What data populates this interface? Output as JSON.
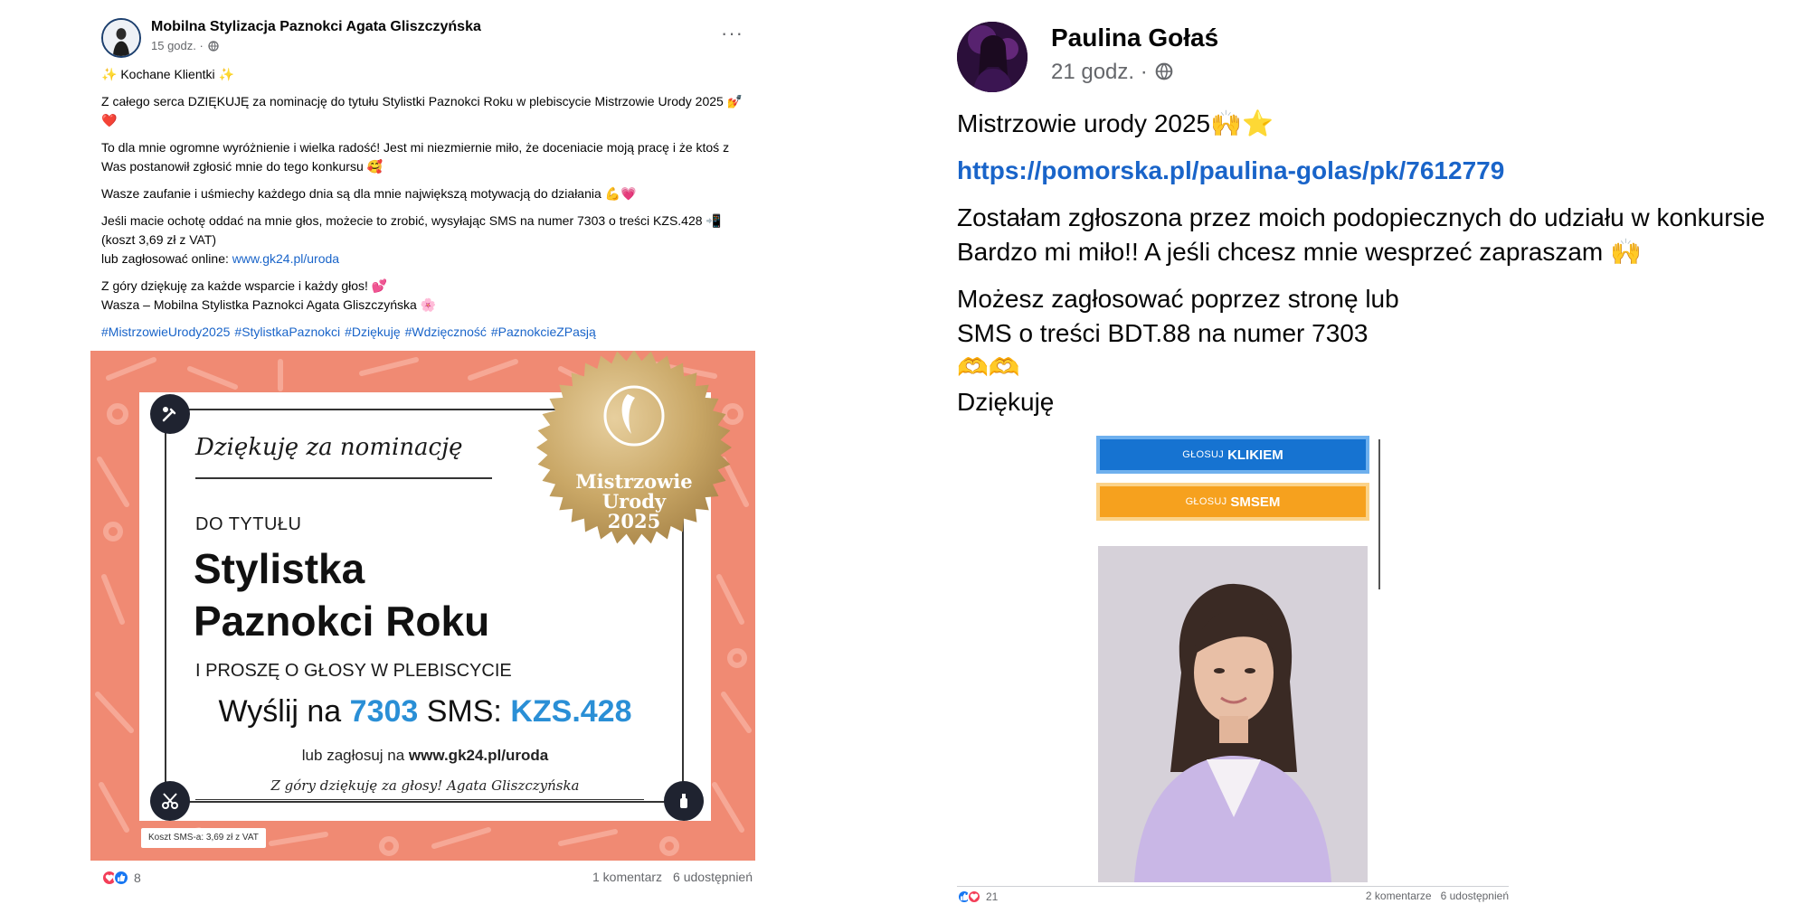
{
  "left_post": {
    "author": "Mobilna Stylizacja Paznokci Agata Gliszczyńska",
    "time": "15 godz. ·",
    "more": "···",
    "greeting": "✨ Kochane Klientki ✨",
    "para1": "Z całego serca DZIĘKUJĘ za nominację do tytułu Stylistki Paznokci Roku w plebiscycie Mistrzowie Urody 2025 💅❤️",
    "para2": "To dla mnie ogromne wyróżnienie i wielka radość! Jest mi niezmiernie miło, że doceniacie moją pracę i że ktoś z Was postanowił zgłosić mnie do tego konkursu 🥰",
    "para3": "Wasze zaufanie i uśmiechy każdego dnia są dla mnie największą motywacją do działania 💪💗",
    "para4_line1": "Jeśli macie ochotę oddać na mnie głos, możecie to zrobić, wysyłając SMS na numer 7303 o treści KZS.428 📲 (koszt 3,69 zł z VAT)",
    "para4_line2_prefix": "lub zagłosować online: ",
    "para4_link": "www.gk24.pl/uroda",
    "para5_line1": "Z góry dziękuję za każde wsparcie i każdy głos! 💕",
    "para5_line2": "Wasza – Mobilna Stylistka Paznokci Agata Gliszczyńska 🌸",
    "hashtags": [
      "#MistrzowieUrody2025",
      "#StylistkaPaznokci",
      "#Dziękuję",
      "#Wdzięczność",
      "#PaznokcieZPasją"
    ],
    "promo": {
      "title": "Dziękuję za nominację",
      "do_tytulu": "DO TYTUŁU",
      "big1": "Stylistka",
      "big2": "Paznokci Roku",
      "prosze": "I PROSZĘ O GŁOSY W PLEBISCYCIE",
      "sms_prefix": "Wyślij na ",
      "sms_number": "7303",
      "sms_mid": " SMS: ",
      "sms_code": "KZS.428",
      "lub_prefix": "lub zagłosuj na ",
      "lub_url": "www.gk24.pl/uroda",
      "signature": "Z góry dziękuję za głosy! Agata Gliszczyńska",
      "seal_line1": "Mistrzowie",
      "seal_line2": "Urody",
      "seal_line3": "2025",
      "koszt": "Koszt SMS-a: 3,69 zł z VAT"
    },
    "reactions_count": "8",
    "comments": "1 komentarz",
    "shares": "6 udostępnień"
  },
  "right_post": {
    "author": "Paulina Gołaś",
    "time": "21 godz. ·",
    "line1": "Mistrzowie urody 2025🙌⭐",
    "link": "https://pomorska.pl/paulina-golas/pk/7612779",
    "para2_line1": "Zostałam zgłoszona przez moich podopiecznych do udziału w konkursie",
    "para2_line2": "Bardzo mi miło!! A jeśli chcesz mnie wesprzeć zapraszam 🙌",
    "para3_line1": "Możesz zagłosować poprzez stronę lub",
    "para3_line2": "SMS o treści BDT.88 na numer 7303",
    "para3_line3": "🫶🫶",
    "para3_line4": "Dziękuję",
    "vote_click_prefix": "GŁOSUJ",
    "vote_click_main": "KLIKIEM",
    "vote_sms_prefix": "GŁOSUJ",
    "vote_sms_main": "SMSEM",
    "reactions_count": "21",
    "comments": "2 komentarze",
    "shares": "6 udostępnień"
  },
  "colors": {
    "link": "#1964c9",
    "promo_bg": "#f08a73",
    "sms_blue": "#2a8fd6",
    "vote_blue": "#1673d1",
    "vote_orange": "#f6a11e"
  }
}
